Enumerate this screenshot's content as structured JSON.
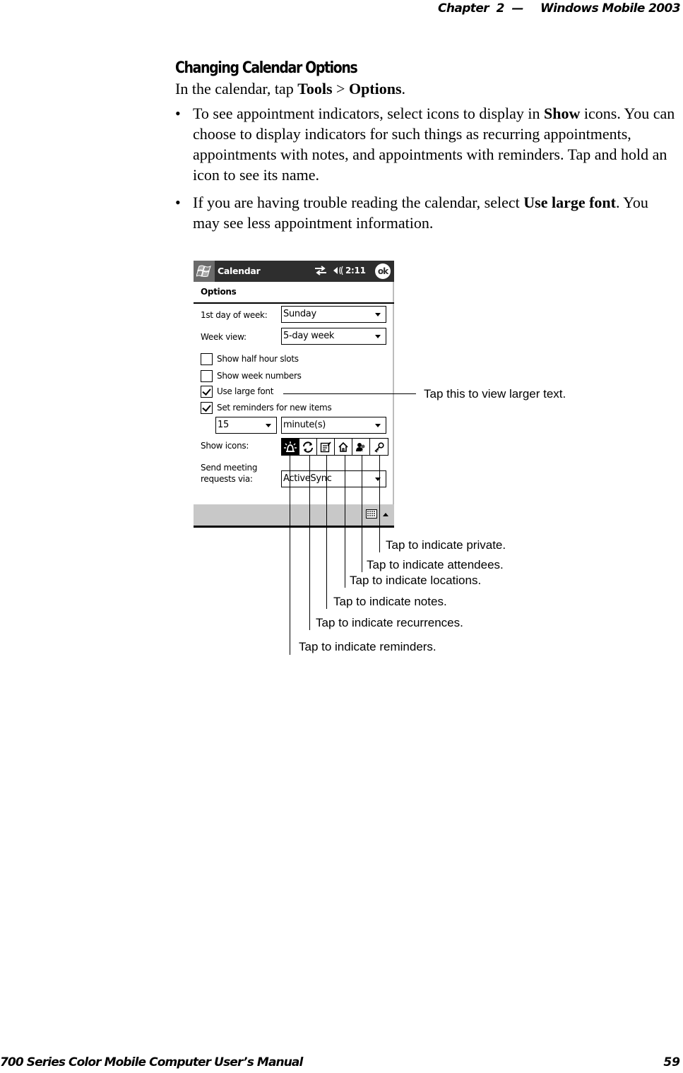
{
  "running_header": {
    "chapter": "Chapter  2  —",
    "title": "Windows Mobile 2003"
  },
  "section": {
    "title": "Changing Calendar Options",
    "intro": {
      "prefix": "In the calendar, tap ",
      "menu1": "Tools",
      "sep": " > ",
      "menu2": "Options",
      "suffix": "."
    },
    "bullets": [
      {
        "dot": "•",
        "pre": "To see appointment indicators, select icons to display in ",
        "bold": "Show",
        "post": " icons. You can choose to display indicators for such things as recurring appointments, appointments with notes, and appointments with reminders. Tap and hold an icon to see its name."
      },
      {
        "dot": "•",
        "pre": "If you are having trouble reading the calendar, select ",
        "bold": "Use large font",
        "post": ". You may see less appointment information."
      }
    ]
  },
  "device": {
    "titlebar": {
      "app_title": "Calendar",
      "time": "2:11",
      "ok_label": "ok"
    },
    "heading": "Options",
    "first_day_label": "1st day of week:",
    "first_day_value": "Sunday",
    "week_view_label": "Week view:",
    "week_view_value": "5-day week",
    "checkboxes": [
      {
        "label": "Show half hour slots",
        "checked": false
      },
      {
        "label": "Show week numbers",
        "checked": false
      },
      {
        "label": "Use large font",
        "checked": true
      },
      {
        "label": "Set reminders for new items",
        "checked": true
      }
    ],
    "reminder_amount": "15",
    "reminder_unit": "minute(s)",
    "show_icons_label": "Show icons:",
    "show_icons": [
      {
        "name": "reminder",
        "icon": "bell-icon",
        "selected": true
      },
      {
        "name": "recurrence",
        "icon": "recurrence-icon",
        "selected": false
      },
      {
        "name": "notes",
        "icon": "notes-icon",
        "selected": false
      },
      {
        "name": "location",
        "icon": "house-icon",
        "selected": false
      },
      {
        "name": "attendees",
        "icon": "attendees-icon",
        "selected": false
      },
      {
        "name": "private",
        "icon": "key-icon",
        "selected": false
      }
    ],
    "send_meeting_label_line1": "Send meeting",
    "send_meeting_label_line2": "requests via:",
    "send_meeting_value": "ActiveSync"
  },
  "callouts": {
    "large_text": "Tap this to view larger text.",
    "private": "Tap to indicate private.",
    "attendees": "Tap to indicate attendees.",
    "locations": "Tap to indicate locations.",
    "notes": "Tap to indicate notes.",
    "recurrences": "Tap to indicate recurrences.",
    "reminders": "Tap to indicate reminders."
  },
  "footer": {
    "manual_title": "700 Series Color Mobile Computer User’s Manual",
    "page_number": "59"
  }
}
